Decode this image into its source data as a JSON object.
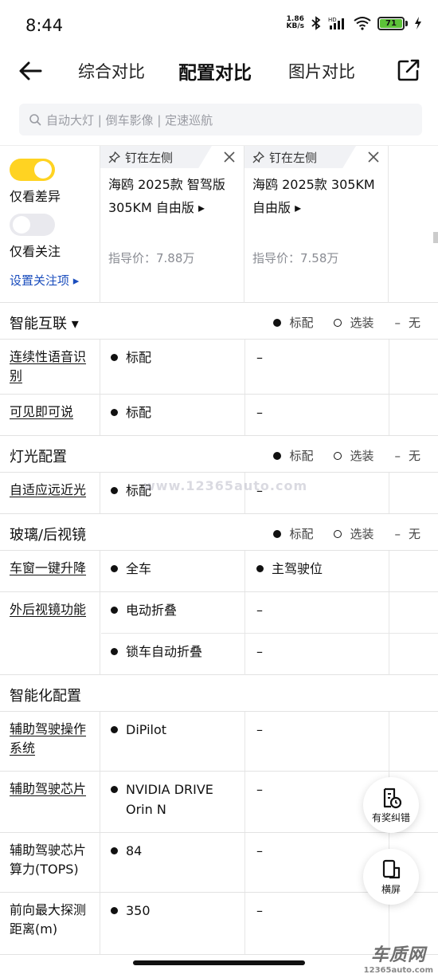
{
  "status": {
    "time": "8:44",
    "speed_value": "1.86",
    "speed_unit": "KB/s",
    "battery": "71",
    "net_label": "HD"
  },
  "header": {
    "tabs": [
      "综合对比",
      "配置对比",
      "图片对比"
    ],
    "active_tab": 1
  },
  "search": {
    "placeholder": "自动大灯 | 倒车影像 | 定速巡航"
  },
  "filters": {
    "diff_label": "仅看差异",
    "diff_on": true,
    "follow_label": "仅看关注",
    "follow_on": false,
    "set_follow": "设置关注项 ▸"
  },
  "cars": [
    {
      "pin": "钉在左侧",
      "name": "海鸥 2025款 智驾版 305KM 自由版 ▸",
      "price": "指导价：7.88万"
    },
    {
      "pin": "钉在左侧",
      "name": "海鸥 2025款 305KM 自由版 ▸",
      "price": "指导价：7.58万"
    }
  ],
  "legend": {
    "std": "标配",
    "opt": "选装",
    "none": "无",
    "none_mark": "–"
  },
  "sections": [
    {
      "title": "智能互联 ▾"
    },
    {
      "title": "灯光配置"
    },
    {
      "title": "玻璃/后视镜"
    },
    {
      "title": "智能化配置"
    }
  ],
  "rows": {
    "voice": {
      "label": "连续性语音识别",
      "c1": "标配",
      "c2": "–"
    },
    "see_say": {
      "label": "可见即可说",
      "c1": "标配",
      "c2": "–"
    },
    "adaptive_beam": {
      "label": "自适应远近光",
      "c1": "标配",
      "c2": "–"
    },
    "window": {
      "label": "车窗一键升降",
      "c1": "全车",
      "c2": "主驾驶位"
    },
    "mirror": {
      "label": "外后视镜功能",
      "c1a": "电动折叠",
      "c2a": "–",
      "c1b": "锁车自动折叠",
      "c2b": "–"
    },
    "adas_os": {
      "label": "辅助驾驶操作系统",
      "c1": "DiPilot",
      "c2": "–"
    },
    "adas_chip": {
      "label": "辅助驾驶芯片",
      "c1": "NVIDIA DRIVE Orin N",
      "c2": "–"
    },
    "chip_power": {
      "label": "辅助驾驶芯片算力(TOPS)",
      "c1": "84",
      "c2": "–"
    },
    "front_range": {
      "label": "前向最大探测距离(m)",
      "c1": "350",
      "c2": "–"
    }
  },
  "watermark": "www.12365auto.com",
  "fabs": {
    "report": "有奖纠错",
    "landscape": "横屏"
  },
  "brand": {
    "name": "车质网",
    "url": "12365auto.com"
  },
  "colors": {
    "accent": "#ffd322",
    "link": "#1a4dbd",
    "muted": "#8a8c93"
  }
}
